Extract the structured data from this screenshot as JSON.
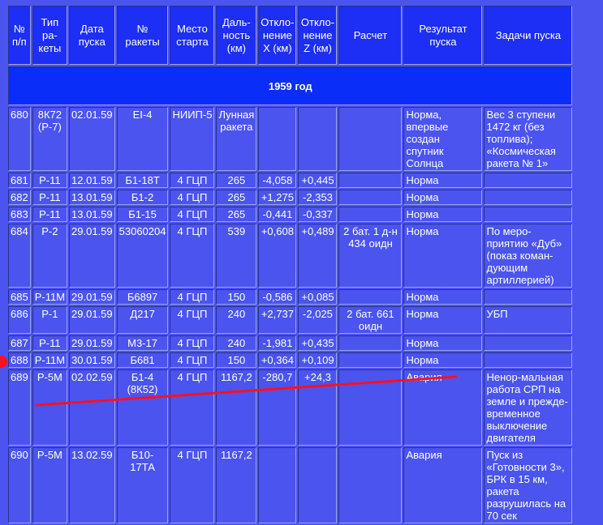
{
  "headers": {
    "num": "№ п/п",
    "type": "Тип ра-кеты",
    "date": "Дата пуска",
    "rocket_no": "№ ракеты",
    "site": "Место старта",
    "range": "Даль-ность (км)",
    "dev_x": "Откло-нение X (км)",
    "dev_z": "Откло-нение Z (км)",
    "calc": "Расчет",
    "result": "Результат пуска",
    "tasks": "Задачи пуска"
  },
  "year": "1959 год",
  "rows": [
    {
      "num": "680",
      "type": "8К72 (Р-7)",
      "date": "02.01.59",
      "rocket_no": "ЕI-4",
      "site": "НИИП-5",
      "range": "Лунная ракета",
      "dev_x": "",
      "dev_z": "",
      "calc": "",
      "result": "Норма, впервые создан спутник Солнца",
      "tasks": "Вес 3 ступени 1472 кг (без топлива); «Космическая ракета № 1»"
    },
    {
      "num": "681",
      "type": "Р-11",
      "date": "12.01.59",
      "rocket_no": "Б1-18Т",
      "site": "4 ГЦП",
      "range": "265",
      "dev_x": "-4,058",
      "dev_z": "+0,445",
      "calc": "",
      "result": "Норма",
      "tasks": ""
    },
    {
      "num": "682",
      "type": "Р-11",
      "date": "13.01.59",
      "rocket_no": "Б1-2",
      "site": "4 ГЦП",
      "range": "265",
      "dev_x": "+1,275",
      "dev_z": "-2,353",
      "calc": "",
      "result": "Норма",
      "tasks": ""
    },
    {
      "num": "683",
      "type": "Р-11",
      "date": "13.01.59",
      "rocket_no": "Б1-15",
      "site": "4 ГЦП",
      "range": "265",
      "dev_x": "-0,441",
      "dev_z": "-0,337",
      "calc": "",
      "result": "Норма",
      "tasks": ""
    },
    {
      "num": "684",
      "type": "Р-2",
      "date": "29.01.59",
      "rocket_no": "53060204",
      "site": "4 ГЦП",
      "range": "539",
      "dev_x": "+0,608",
      "dev_z": "+0,489",
      "calc": "2 бат. 1 д-н 434 оидн",
      "result": "Норма",
      "tasks": "По меро-приятию «Дуб» (показ коман-дующим артиллерией)"
    },
    {
      "num": "685",
      "type": "Р-11М",
      "date": "29.01.59",
      "rocket_no": "Б6897",
      "site": "4 ГЦП",
      "range": "150",
      "dev_x": "-0,586",
      "dev_z": "+0,085",
      "calc": "",
      "result": "Норма",
      "tasks": ""
    },
    {
      "num": "686",
      "type": "Р-1",
      "date": "29.01.59",
      "rocket_no": "Д217",
      "site": "4 ГЦП",
      "range": "240",
      "dev_x": "+2,737",
      "dev_z": "-2,025",
      "calc": "2 бат. 661 оидн",
      "result": "Норма",
      "tasks": "УБП"
    },
    {
      "num": "687",
      "type": "Р-11",
      "date": "29.01.59",
      "rocket_no": "М3-17",
      "site": "4 ГЦП",
      "range": "240",
      "dev_x": "-1,981",
      "dev_z": "+0,435",
      "calc": "",
      "result": "Норма",
      "tasks": ""
    },
    {
      "num": "688",
      "type": "Р-11М",
      "date": "30.01.59",
      "rocket_no": "Б681",
      "site": "4 ГЦП",
      "range": "150",
      "dev_x": "+0,364",
      "dev_z": "+0,109",
      "calc": "",
      "result": "Норма",
      "tasks": ""
    },
    {
      "num": "689",
      "type": "Р-5М",
      "date": "02.02.59",
      "rocket_no": "Б1-4 (8К52)",
      "site": "4 ГЦП",
      "range": "1167,2",
      "dev_x": "-280,7",
      "dev_z": "+24,3",
      "calc": "",
      "result": "Авария",
      "tasks": "Ненор-мальная работа СРП на земле и прежде-временное выключение двигателя"
    },
    {
      "num": "690",
      "type": "Р-5М",
      "date": "13.02.59",
      "rocket_no": "Б10-17ТА",
      "site": "4 ГЦП",
      "range": "1167,2",
      "dev_x": "",
      "dev_z": "",
      "calc": "",
      "result": "Авария",
      "tasks": "Пуск из «Готовности 3», БРК в 15 км, ракета разрушилась на 70 сек"
    }
  ],
  "colors": {
    "page_bg": "#4b54ee",
    "header_bg": "#1d2ef5",
    "year_bg": "#0a2ef8",
    "annotation_red": "#ff1020"
  }
}
